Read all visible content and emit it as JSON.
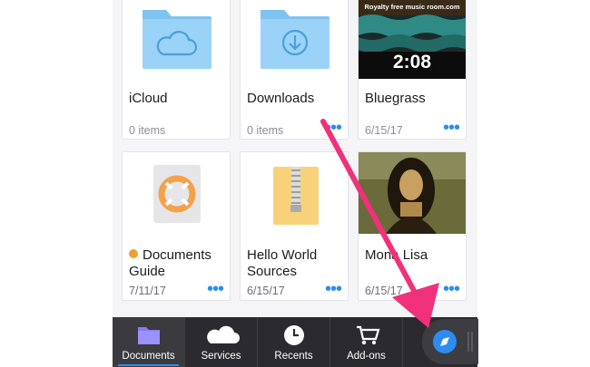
{
  "files": [
    {
      "name": "iCloud",
      "meta": "0 items",
      "icon": "icloud-folder-icon"
    },
    {
      "name": "Downloads",
      "meta": "0 items",
      "icon": "downloads-folder-icon"
    },
    {
      "name": "Bluegrass",
      "meta": "6/15/17",
      "duration": "2:08",
      "video_text": "Royalty free music room.com"
    },
    {
      "name": "Documents Guide",
      "meta": "7/11/17",
      "icon": "lifebuoy-icon",
      "tag_color": "#f0a030"
    },
    {
      "name": "Hello World Sources",
      "meta": "6/15/17",
      "icon": "zip-archive-icon"
    },
    {
      "name": "Mona Lisa",
      "meta": "6/15/17",
      "icon": "mona-lisa-image"
    }
  ],
  "tabbar": {
    "tabs": [
      {
        "label": "Documents",
        "icon": "folder-icon",
        "active": true
      },
      {
        "label": "Services",
        "icon": "cloud-icon"
      },
      {
        "label": "Recents",
        "icon": "clock-icon"
      },
      {
        "label": "Add-ons",
        "icon": "cart-icon"
      }
    ],
    "browser_icon": "compass-icon"
  },
  "colors": {
    "accent": "#2d8cf0",
    "arrow": "#f0307a",
    "folder": "#8fcdf5",
    "tabbar": "#2b2b2f"
  }
}
